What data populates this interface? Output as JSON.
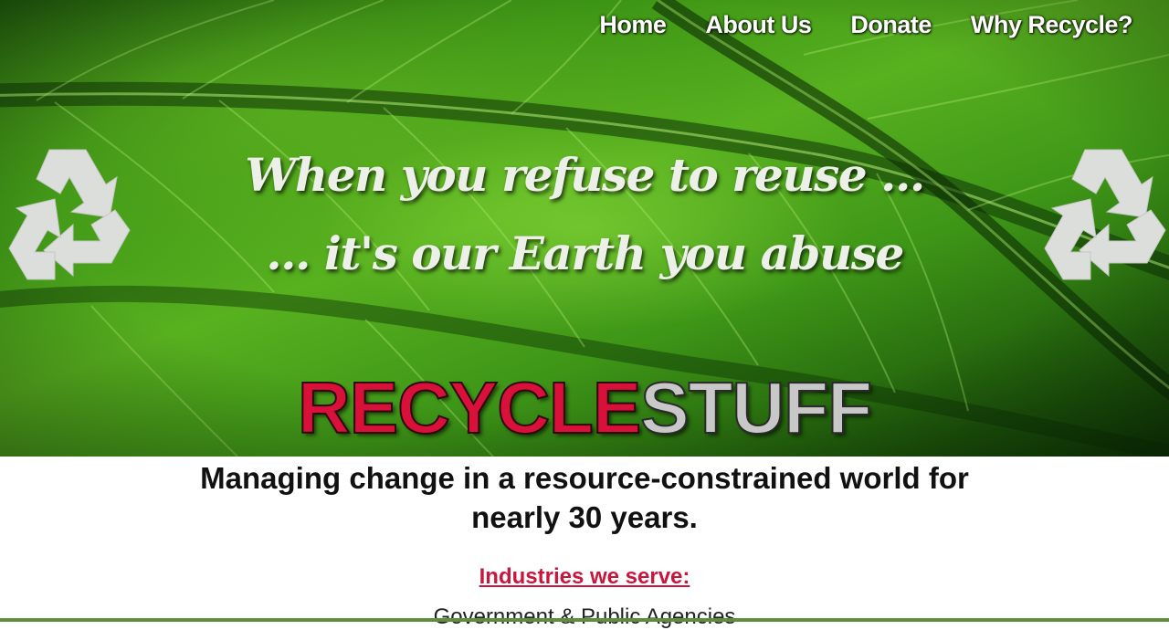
{
  "nav": {
    "items": [
      {
        "label": "Home"
      },
      {
        "label": "About Us"
      },
      {
        "label": "Donate"
      },
      {
        "label": "Why Recycle?"
      }
    ]
  },
  "hero": {
    "slogan_line1": "When you refuse to reuse ...",
    "slogan_line2": "... it's our Earth you abuse",
    "brand_part1": "RECYCLE",
    "brand_part2": "STUFF",
    "background": "green leaf",
    "side_icon": "recycle-icon"
  },
  "main": {
    "tagline": "Managing change in a resource-constrained world for nearly 30 years.",
    "industries_heading": "Industries we serve:",
    "industries": [
      "Government & Public Agencies"
    ]
  },
  "colors": {
    "brand_red": "#d8103a",
    "brand_gray": "#c8c8c8",
    "heading_red": "#c8163c",
    "leaf_green": "#4aa41b",
    "bottom_bar": "#5d8f3e"
  }
}
